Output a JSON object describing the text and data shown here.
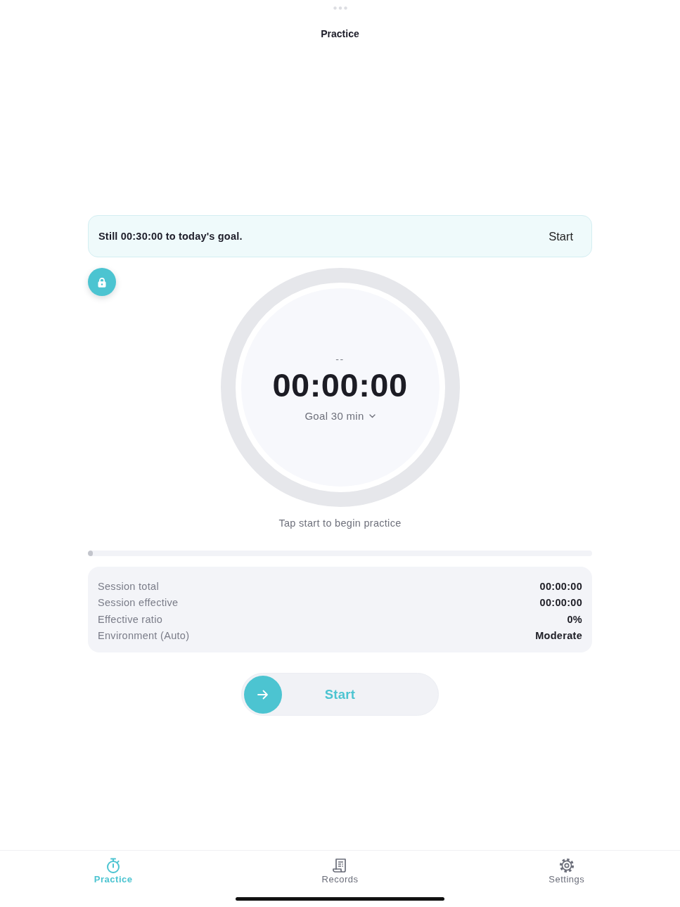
{
  "top_bar": {
    "title": "Practice"
  },
  "goal_banner": {
    "message": "Still 00:30:00 to today's goal.",
    "action": "Start"
  },
  "timer": {
    "status": "--",
    "elapsed": "00:00:00",
    "goal": "Goal 30 min",
    "hint": "Tap start to begin practice"
  },
  "progress": {
    "level": 0.01
  },
  "session_stats": [
    {
      "label": "Session total",
      "value": "00:00:00"
    },
    {
      "label": "Session effective",
      "value": "00:00:00"
    },
    {
      "label": "Effective ratio",
      "value": "0%"
    },
    {
      "label": "Environment (Auto)",
      "value": "Moderate"
    }
  ],
  "start_button": {
    "label": "Start"
  },
  "tabs": [
    {
      "label": "Practice",
      "selected": true
    },
    {
      "label": "Records",
      "selected": false
    },
    {
      "label": "Settings",
      "selected": false
    }
  ]
}
